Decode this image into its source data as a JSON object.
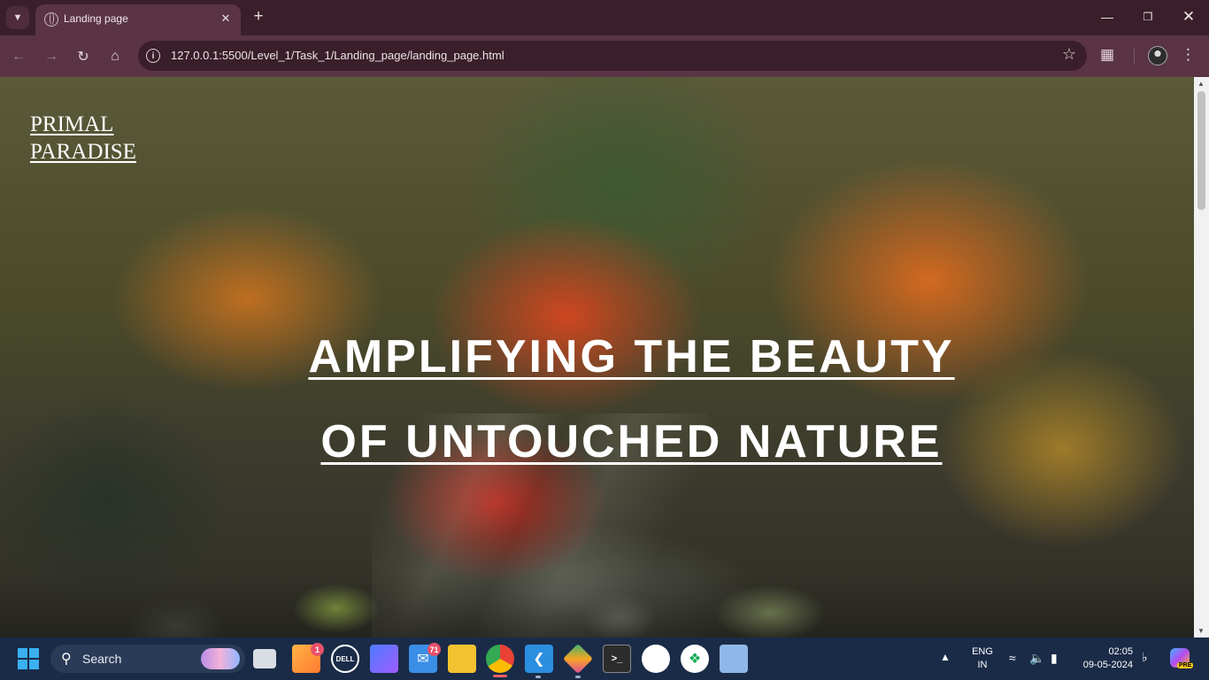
{
  "browser": {
    "tab_title": "Landing page",
    "url": "127.0.0.1:5500/Level_1/Task_1/Landing_page/landing_page.html",
    "new_tab_symbol": "+",
    "icons": [
      "tab-list-icon",
      "globe-icon",
      "close-icon",
      "plus-icon",
      "back-icon",
      "forward-icon",
      "reload-icon",
      "home-icon",
      "info-icon",
      "star-icon",
      "extensions-icon",
      "profile-avatar",
      "menu-icon"
    ]
  },
  "page": {
    "brand_line1": "PRIMAL",
    "brand_line2": "PARADISE",
    "hero_line1": "AMPLIFYING THE BEAUTY",
    "hero_line2": "OF UNTOUCHED NATURE"
  },
  "taskbar": {
    "search_label": "Search",
    "notification_badge_widget": "1",
    "mail_badge": "71",
    "language_line1": "ENG",
    "language_line2": "IN",
    "time": "02:05",
    "date": "09-05-2024",
    "copilot_badge": "PRE",
    "dell_label": "DELL"
  },
  "colors": {
    "tab_bar": "#3a1f2a",
    "toolbar": "#5a3444",
    "omnibox": "#3a1f2a",
    "taskbar": "#1a2b48",
    "accent_start": "#3ab0f0",
    "text_on_image": "#ffffff"
  }
}
